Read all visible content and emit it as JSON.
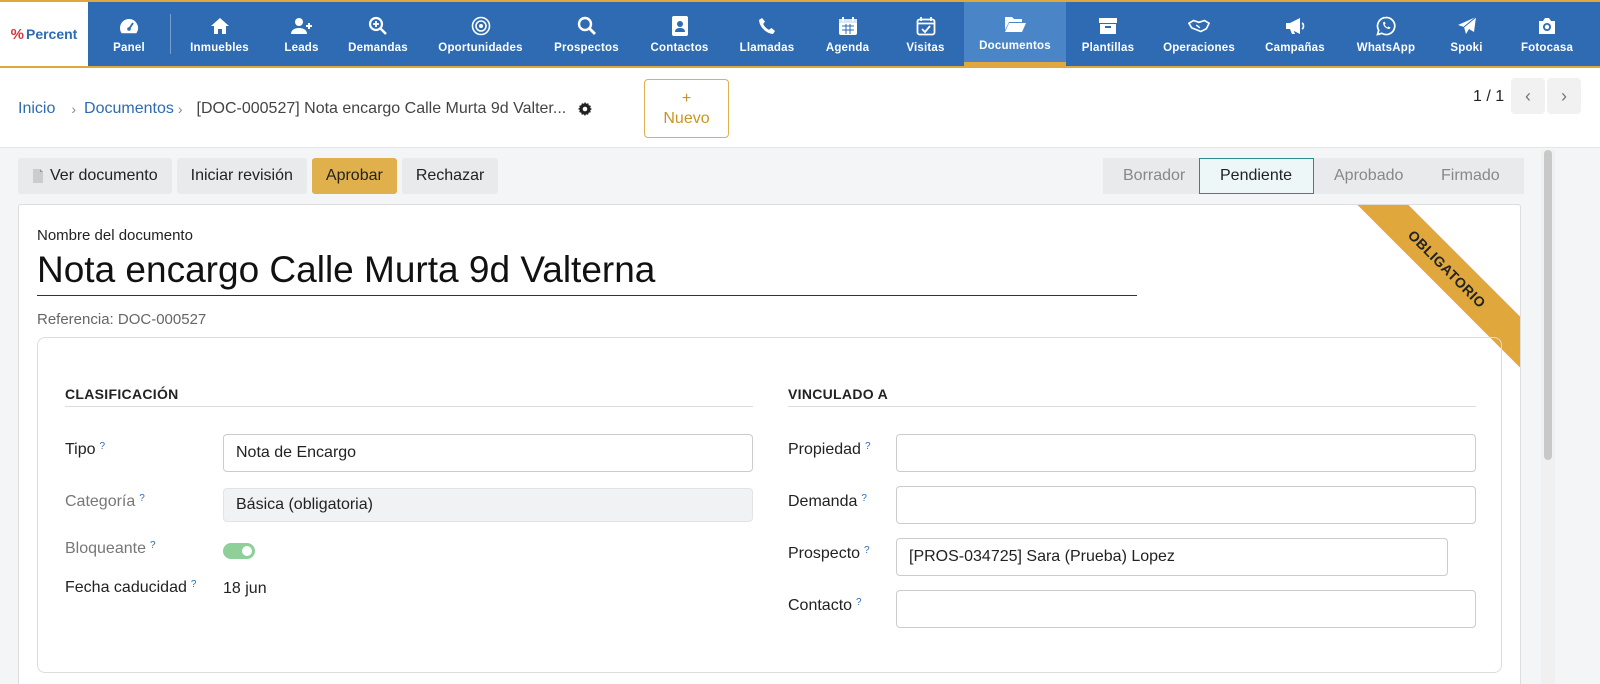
{
  "logo": {
    "mark": "%",
    "text": "Percent"
  },
  "nav": [
    {
      "label": "Panel",
      "icon": "dashboard-icon"
    },
    {
      "label": "Inmuebles",
      "icon": "home-icon"
    },
    {
      "label": "Leads",
      "icon": "user-plus-icon"
    },
    {
      "label": "Demandas",
      "icon": "zoom-in-icon"
    },
    {
      "label": "Oportunidades",
      "icon": "target-icon"
    },
    {
      "label": "Prospectos",
      "icon": "search-icon"
    },
    {
      "label": "Contactos",
      "icon": "address-book-icon"
    },
    {
      "label": "Llamadas",
      "icon": "phone-icon"
    },
    {
      "label": "Agenda",
      "icon": "calendar-icon"
    },
    {
      "label": "Visitas",
      "icon": "calendar-check-icon"
    },
    {
      "label": "Documentos",
      "icon": "folder-open-icon",
      "active": true
    },
    {
      "label": "Plantillas",
      "icon": "archive-icon"
    },
    {
      "label": "Operaciones",
      "icon": "handshake-icon"
    },
    {
      "label": "Campañas",
      "icon": "megaphone-icon"
    },
    {
      "label": "WhatsApp",
      "icon": "whatsapp-icon"
    },
    {
      "label": "Spoki",
      "icon": "paper-plane-icon"
    },
    {
      "label": "Fotocasa",
      "icon": "camera-icon"
    }
  ],
  "breadcrumb": {
    "home": "Inicio",
    "section": "Documentos",
    "current": "[DOC-000527] Nota encargo Calle Murta 9d Valter..."
  },
  "new_button": {
    "plus": "+",
    "label": "Nuevo"
  },
  "pager": {
    "text": "1 / 1"
  },
  "actions": {
    "view": "Ver documento",
    "review": "Iniciar revisión",
    "approve": "Aprobar",
    "reject": "Rechazar"
  },
  "status": {
    "stages": [
      "Borrador",
      "Pendiente",
      "Aprobado",
      "Firmado"
    ],
    "current": "Pendiente"
  },
  "ribbon": "OBLIGATORIO",
  "form": {
    "name_label": "Nombre del documento",
    "title": "Nota encargo Calle Murta 9d Valterna",
    "reference": "Referencia: DOC-000527",
    "classification": {
      "heading": "CLASIFICACIÓN",
      "tipo_label": "Tipo",
      "tipo_value": "Nota de Encargo",
      "categoria_label": "Categoría",
      "categoria_value": "Básica (obligatoria)",
      "bloqueante_label": "Bloqueante",
      "bloqueante_value": true,
      "fecha_label": "Fecha caducidad",
      "fecha_value": "18 jun"
    },
    "linked": {
      "heading": "VINCULADO A",
      "propiedad_label": "Propiedad",
      "propiedad_value": "",
      "demanda_label": "Demanda",
      "demanda_value": "",
      "prospecto_label": "Prospecto",
      "prospecto_value": "[PROS-034725] Sara (Prueba) Lopez",
      "contacto_label": "Contacto",
      "contacto_value": ""
    },
    "help_marker": "?"
  }
}
